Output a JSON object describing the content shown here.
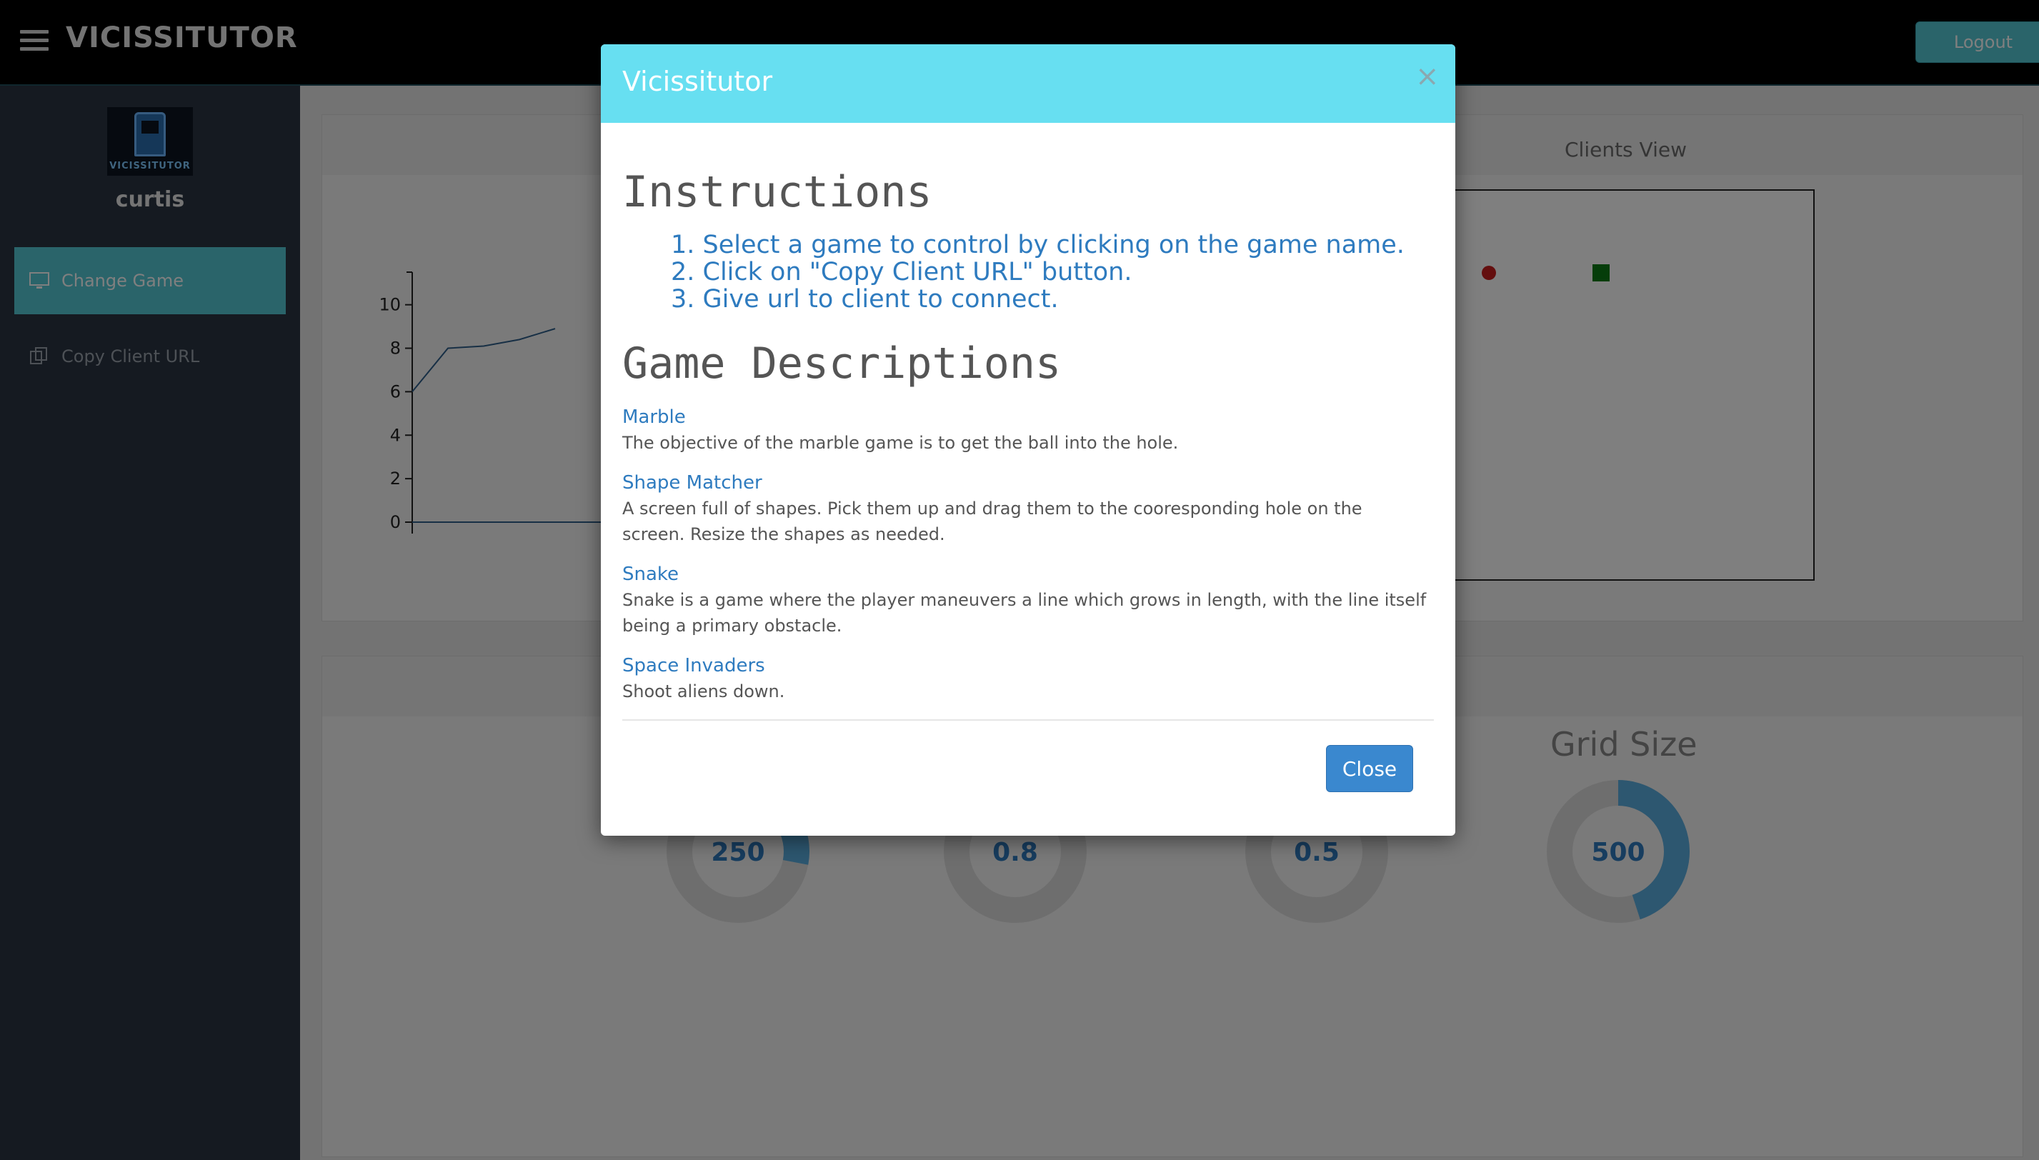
{
  "header": {
    "brand": "VICISSITUTOR",
    "logout_label": "Logout"
  },
  "sidebar": {
    "logo_text": "VICISSITUTOR",
    "username": "curtis",
    "items": [
      {
        "label": "Change Game",
        "icon": "monitor-icon",
        "active": true
      },
      {
        "label": "Copy Client URL",
        "icon": "copy-icon",
        "active": false
      }
    ]
  },
  "clients_view": {
    "title": "Clients View"
  },
  "chart_data": {
    "type": "line",
    "x": [
      0,
      1,
      2,
      3,
      4
    ],
    "y": [
      6,
      8,
      8.1,
      8.4,
      8.9
    ],
    "yticks": [
      0,
      2,
      4,
      6,
      8,
      10
    ],
    "ylim": [
      0,
      11.5
    ],
    "title": "",
    "xlabel": "",
    "ylabel": ""
  },
  "gauges": [
    {
      "value": "250",
      "fill": 0.28
    },
    {
      "value": "0.8",
      "fill": 0.0
    },
    {
      "value": "0.5",
      "fill": 0.15
    },
    {
      "value": "500",
      "fill": 0.45
    }
  ],
  "grid_size_title": "Grid Size",
  "modal": {
    "title": "Vicissitutor",
    "close_x": "×",
    "instructions_heading": "Instructions",
    "steps": [
      "1. Select a game to control by clicking on the game name.",
      "2. Click on \"Copy Client URL\" button.",
      "3. Give url to client to connect."
    ],
    "games_heading": "Game Descriptions",
    "games": [
      {
        "name": "Marble",
        "description": "The objective of the marble game is to get the ball into the hole."
      },
      {
        "name": "Shape Matcher",
        "description": "A screen full of shapes. Pick them up and drag them to the cooresponding hole on the screen. Resize the shapes as needed."
      },
      {
        "name": "Snake",
        "description": "Snake is a game where the player maneuvers a line which grows in length, with the line itself being a primary obstacle."
      },
      {
        "name": "Space Invaders",
        "description": "Shoot aliens down."
      }
    ],
    "close_label": "Close"
  },
  "colors": {
    "accent": "#55c8d4",
    "header_modal": "#67dff1",
    "link": "#2e7bbf",
    "sidebar": "#2a3542"
  }
}
